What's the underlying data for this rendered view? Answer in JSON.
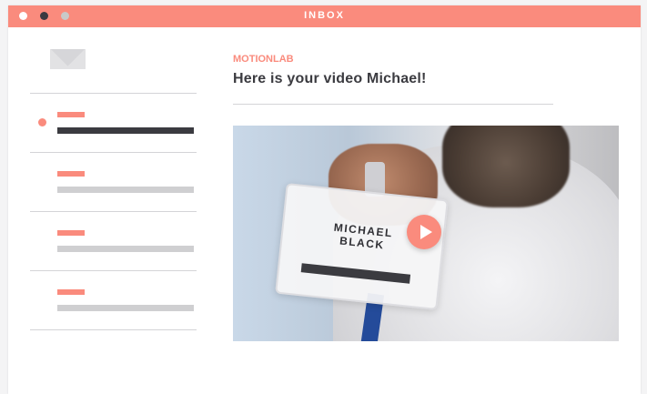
{
  "window": {
    "title": "INBOX",
    "controls": [
      {
        "name": "close-control",
        "color": "#ffffff"
      },
      {
        "name": "minimize-control",
        "color": "#3a3a40"
      },
      {
        "name": "maximize-control",
        "color": "#c9c9c9"
      }
    ]
  },
  "sidebar": {
    "icon": "mail-icon",
    "items": [
      {
        "state": "unread-selected"
      },
      {
        "state": "read"
      },
      {
        "state": "read"
      },
      {
        "state": "read"
      }
    ]
  },
  "message": {
    "sender": "MOTIONLAB",
    "subject": "Here is your video Michael!",
    "video": {
      "badge_name": "MICHAEL\nBLACK",
      "play_icon": "play-icon"
    }
  },
  "colors": {
    "accent": "#fa8b7d",
    "dark": "#3b3b40",
    "divider": "#d4d4d7",
    "muted_bar": "#cfcfd1"
  }
}
